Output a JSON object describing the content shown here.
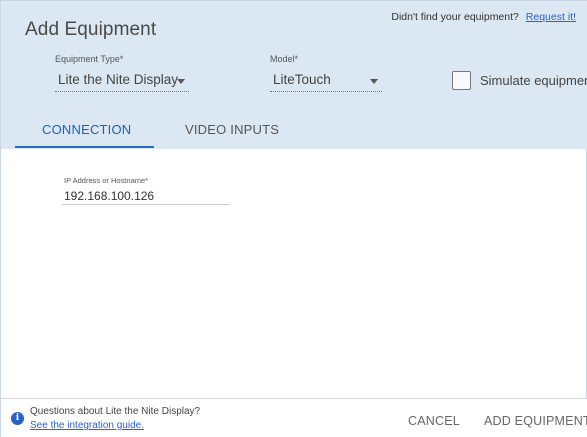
{
  "dialog": {
    "title": "Add Equipment",
    "request_text": "Didn't find your equipment?",
    "request_link": "Request it!"
  },
  "fields": {
    "equipment_type": {
      "label": "Equipment Type*",
      "value": "Lite the Nite Display"
    },
    "model": {
      "label": "Model*",
      "value": "LiteTouch"
    },
    "simulate": {
      "label": "Simulate equipment",
      "checked": false
    }
  },
  "tabs": [
    {
      "label": "CONNECTION",
      "active": true
    },
    {
      "label": "VIDEO INPUTS",
      "active": false
    }
  ],
  "connection": {
    "ip_label": "IP Address or Hostname*",
    "ip_value": "192.168.100.126"
  },
  "footer": {
    "info_icon": "info-icon",
    "question": "Questions about Lite the Nite Display?",
    "guide_link": "See the integration guide.",
    "cancel_label": "CANCEL",
    "add_label": "ADD EQUIPMENT"
  },
  "colors": {
    "header_bg": "#dbe7f3",
    "accent": "#2d6cc0",
    "link": "#2a62c9"
  }
}
